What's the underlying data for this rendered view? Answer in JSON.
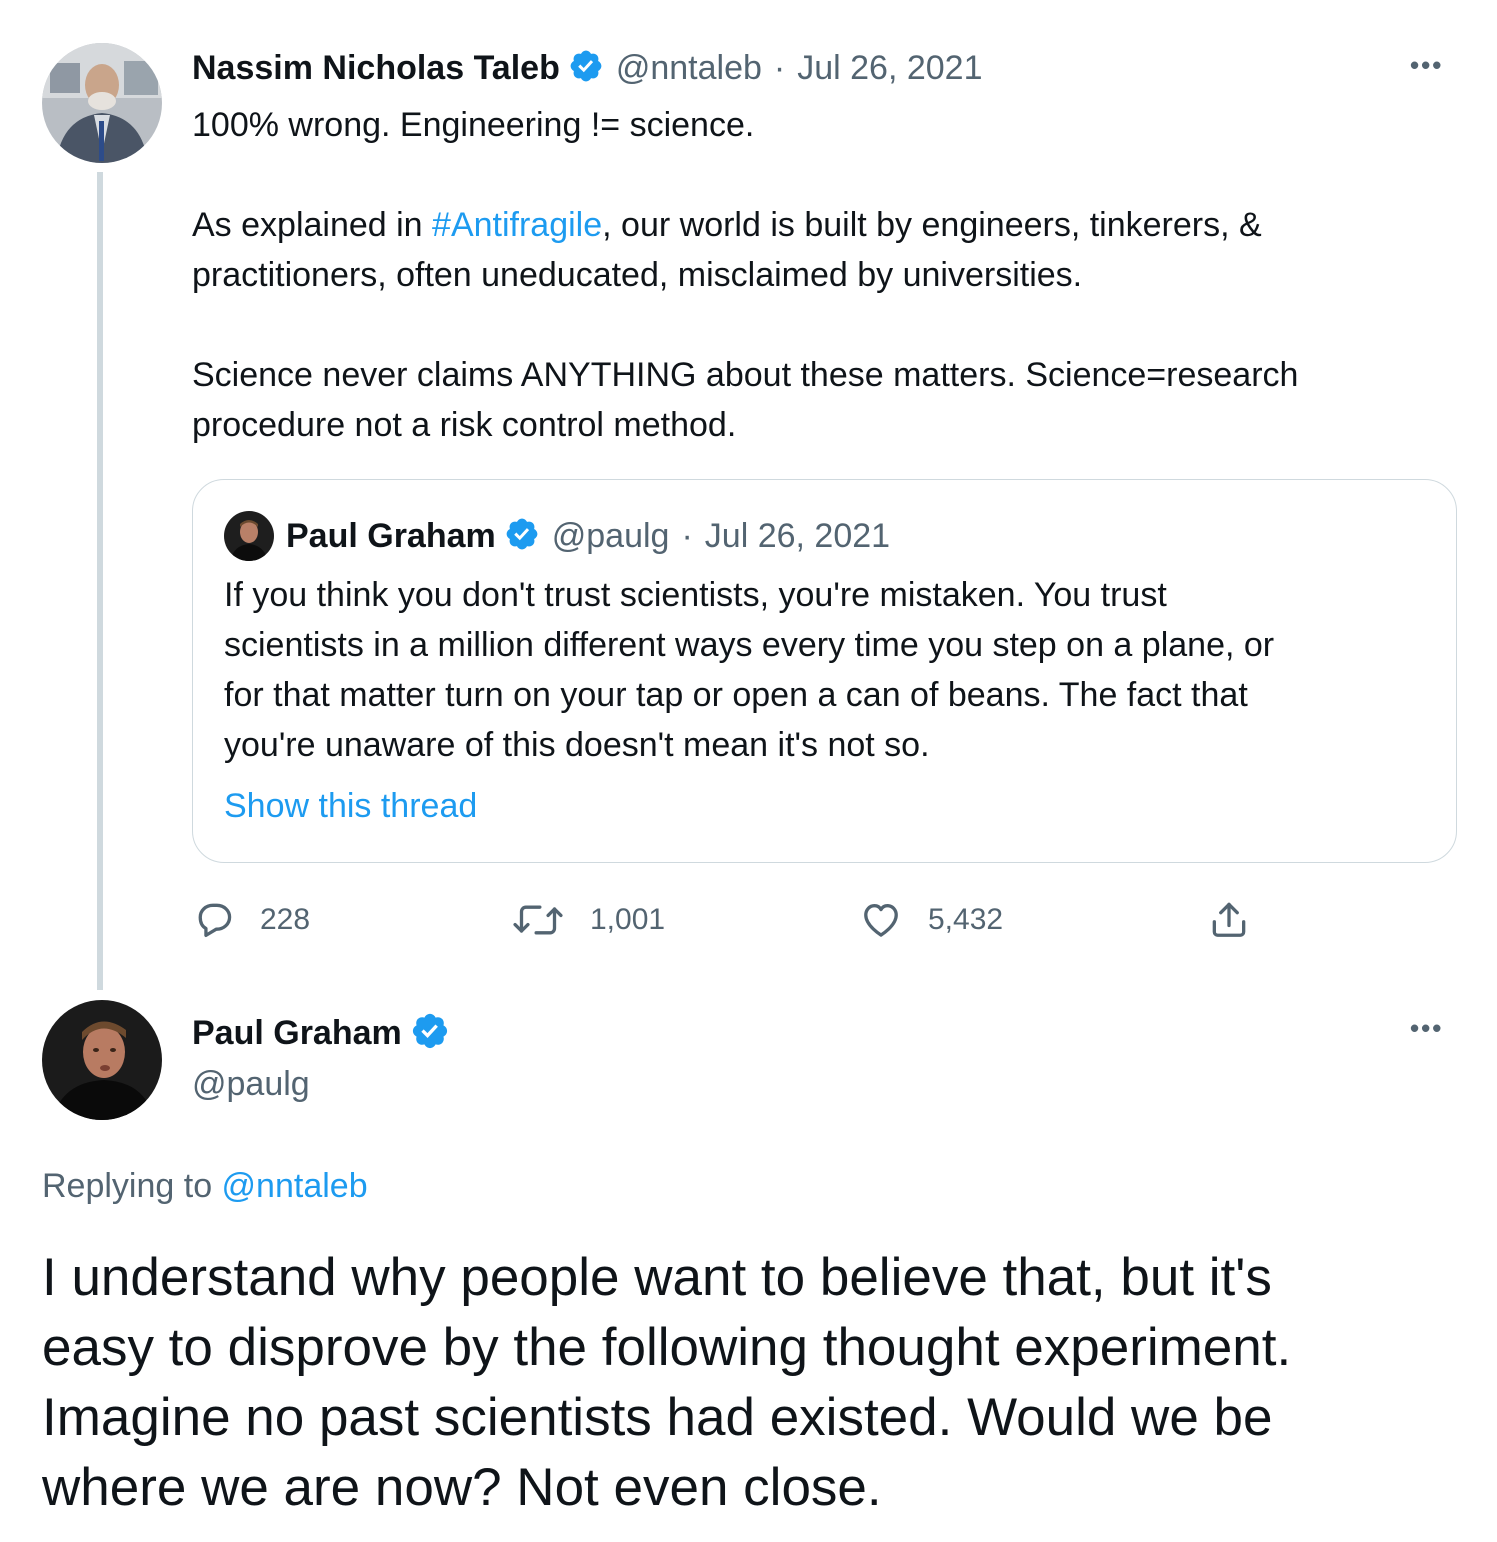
{
  "main_tweet": {
    "author_name": "Nassim Nicholas Taleb",
    "author_handle": "@nntaleb",
    "separator": "·",
    "date": "Jul 26, 2021",
    "more_label": "•••",
    "text": {
      "line1": "100% wrong. Engineering != science.",
      "para2_prefix": "As explained in ",
      "hashtag": "#Antifragile",
      "para2_suffix": ", our world is built by engineers, tinkerers, &",
      "para2_line2": "practitioners, often uneducated, misclaimed by universities.",
      "para3_line1": "Science never claims ANYTHING about these matters. Science=research",
      "para3_line2": "procedure not a risk control method."
    },
    "quoted_tweet": {
      "author_name": "Paul Graham",
      "author_handle": "@paulg",
      "separator": "·",
      "date": "Jul 26, 2021",
      "lines": [
        "If you think you don't trust scientists, you're mistaken. You trust",
        "scientists in a million different ways every time you step on a plane, or",
        "for that matter turn on your tap or open a can of beans. The fact that",
        "you're unaware of this doesn't mean it's not so."
      ],
      "show_thread": "Show this thread"
    },
    "actions": {
      "replies": "228",
      "retweets": "1,001",
      "likes": "5,432"
    }
  },
  "reply_tweet": {
    "author_name": "Paul Graham",
    "author_handle": "@paulg",
    "more_label": "•••",
    "replying_prefix": "Replying to ",
    "replying_handle": "@nntaleb",
    "lines": [
      "I understand why people want to believe that, but it's",
      "easy to disprove by the following thought experiment.",
      "Imagine no past scientists had existed. Would we be",
      "where we are now? Not even close."
    ]
  },
  "colors": {
    "link": "#1d9bf0",
    "secondary_text": "#536471",
    "border": "#cfd9de",
    "verified_badge": "#1d9bf0"
  },
  "icons": {
    "verified": "verified-badge-icon",
    "reply": "reply-bubble-icon",
    "retweet": "retweet-icon",
    "like": "heart-icon",
    "share": "share-upload-icon",
    "more": "more-dots-icon"
  }
}
